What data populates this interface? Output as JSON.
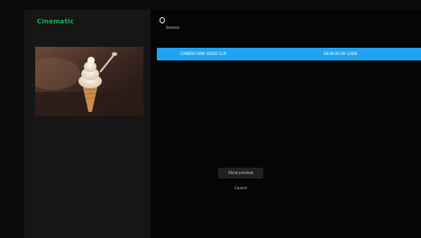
{
  "sidebar": {
    "app_title": "Cinematic",
    "thumbnail": "ice-cream-cone-photo"
  },
  "header": {
    "icon": "record-icon",
    "title": "Session"
  },
  "list": {
    "rows": [
      {
        "left_text": "CAMERA RAW VIDEO CLIP",
        "right_text": "00:00:00:00  1/400"
      }
    ]
  },
  "menu": {
    "items": [
      {
        "label": "Show preview",
        "selected": true
      },
      {
        "label": "Cancel",
        "selected": false
      }
    ]
  },
  "colors": {
    "accent_green": "#1fae5a",
    "accent_blue": "#1fa3f2",
    "background": "#0b0b0b"
  }
}
